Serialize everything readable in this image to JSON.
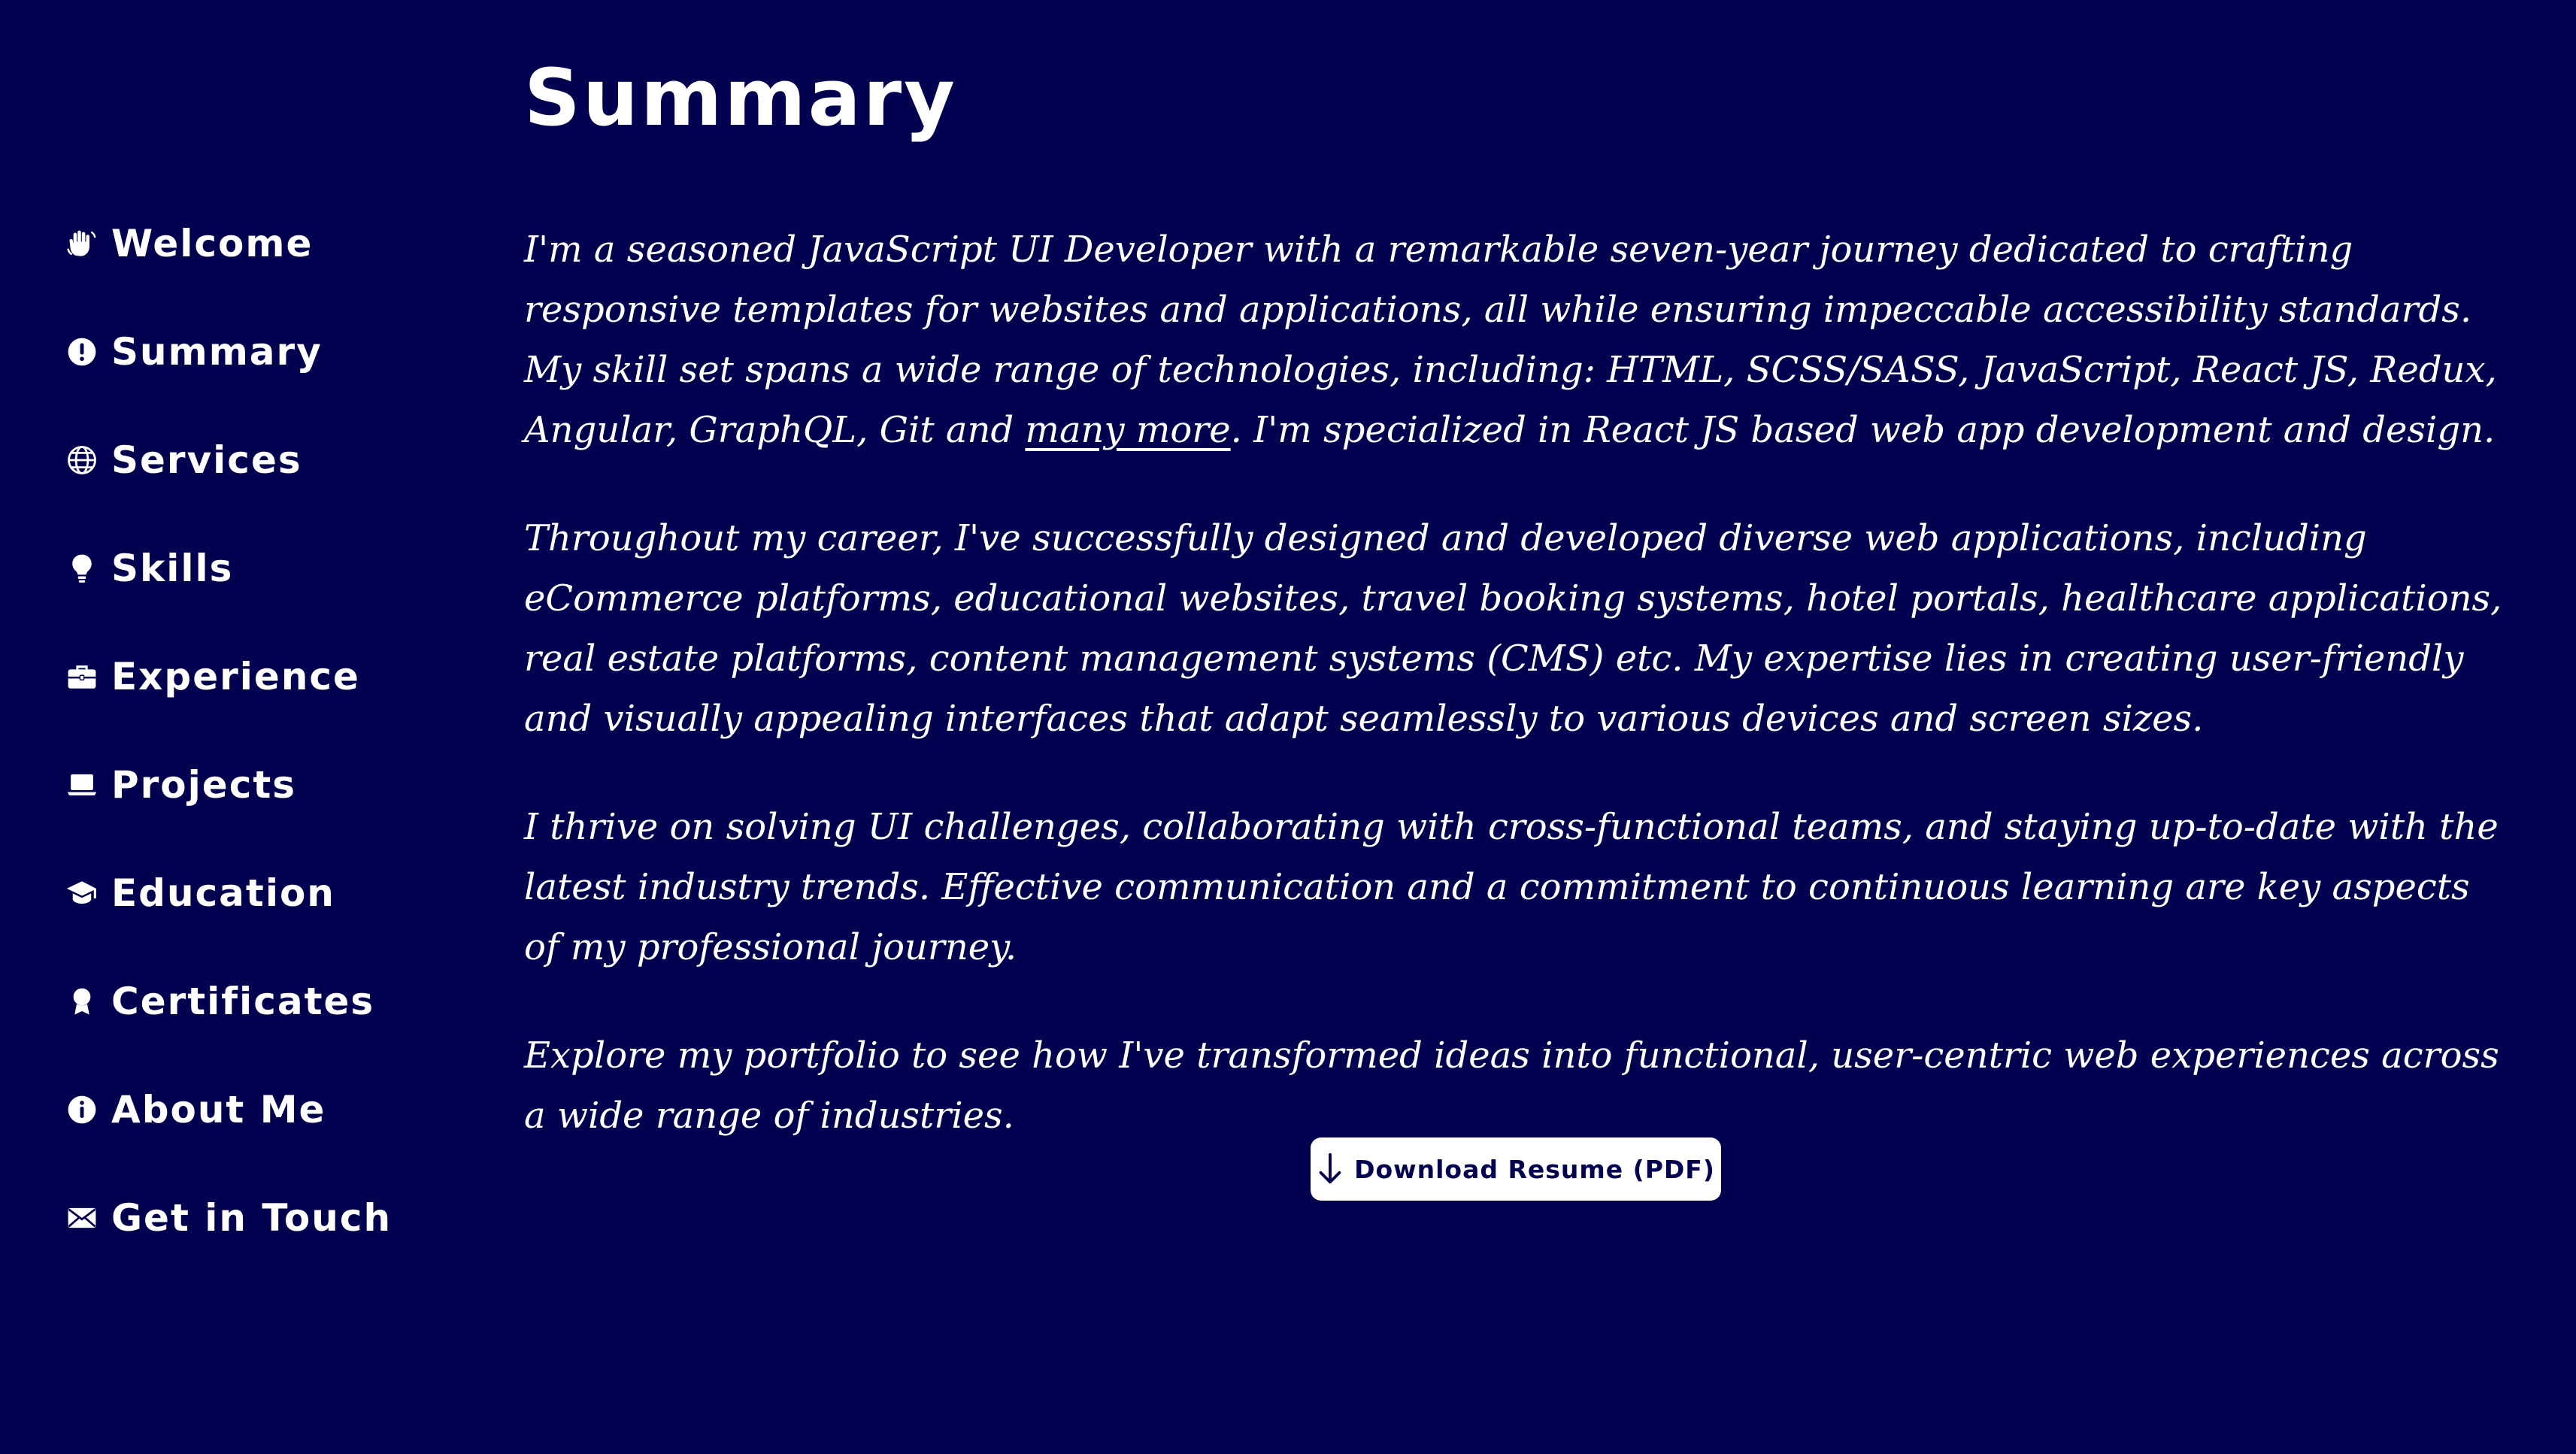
{
  "nav": {
    "items": [
      {
        "label": "Welcome",
        "icon": "waving-hand-icon"
      },
      {
        "label": "Summary",
        "icon": "exclamation-circle-icon"
      },
      {
        "label": "Services",
        "icon": "globe-icon"
      },
      {
        "label": "Skills",
        "icon": "lightbulb-icon"
      },
      {
        "label": "Experience",
        "icon": "briefcase-icon"
      },
      {
        "label": "Projects",
        "icon": "laptop-icon"
      },
      {
        "label": "Education",
        "icon": "graduation-cap-icon"
      },
      {
        "label": "Certificates",
        "icon": "award-icon"
      },
      {
        "label": "About Me",
        "icon": "info-circle-icon"
      },
      {
        "label": "Get in Touch",
        "icon": "envelope-icon"
      }
    ]
  },
  "main": {
    "title": "Summary",
    "p1_before_link": "I'm a seasoned JavaScript UI Developer with a remarkable seven-year journey dedicated to crafting responsive templates for websites and applications, all while ensuring impeccable accessibility standards. My skill set spans a wide range of technologies, including: HTML, SCSS/SASS, JavaScript, React JS, Redux, Angular, GraphQL, Git and ",
    "p1_link": "many more",
    "p1_after_link": ". I'm specialized in React JS based web app development and design.",
    "p2": "Throughout my career, I've successfully designed and developed diverse web applications, including eCommerce platforms, educational websites, travel booking systems, hotel portals, healthcare applications, real estate platforms, content management systems (CMS) etc. My expertise lies in creating user-friendly and visually appealing interfaces that adapt seamlessly to various devices and screen sizes.",
    "p3": "I thrive on solving UI challenges, collaborating with cross-functional teams, and staying up-to-date with the latest industry trends. Effective communication and a commitment to continuous learning are key aspects of my professional journey.",
    "p4": "Explore my portfolio to see how I've transformed ideas into functional, user-centric web experiences across a wide range of industries.",
    "download_label": "Download Resume (PDF)",
    "download_icon": "arrow-down-icon"
  },
  "colors": {
    "background": "#01014f",
    "text": "#ffffff",
    "button_bg": "#ffffff",
    "button_text": "#01014f"
  }
}
